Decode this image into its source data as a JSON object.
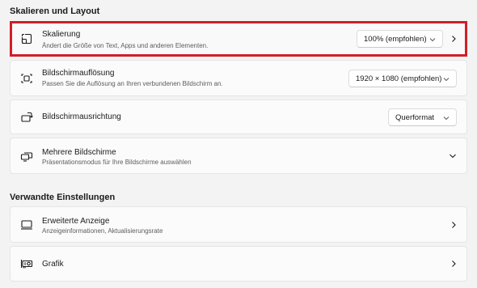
{
  "sections": {
    "layout_title": "Skalieren und Layout",
    "related_title": "Verwandte Einstellungen"
  },
  "scaling": {
    "title": "Skalierung",
    "subtitle": "Ändert die Größe von Text, Apps und anderen Elementen.",
    "value": "100% (empfohlen)",
    "icon": "scale-icon"
  },
  "resolution": {
    "title": "Bildschirmauflösung",
    "subtitle": "Passen Sie die Auflösung an Ihren verbundenen Bildschirm an.",
    "value": "1920 × 1080 (empfohlen)",
    "icon": "resolution-icon"
  },
  "orientation": {
    "title": "Bildschirmausrichtung",
    "value": "Querformat",
    "icon": "orientation-icon"
  },
  "multiple": {
    "title": "Mehrere Bildschirme",
    "subtitle": "Präsentationsmodus für Ihre Bildschirme auswählen",
    "icon": "multiple-displays-icon"
  },
  "advanced": {
    "title": "Erweiterte Anzeige",
    "subtitle": "Anzeigeinformationen, Aktualisierungsrate",
    "icon": "monitor-icon"
  },
  "graphics": {
    "title": "Grafik",
    "icon": "graphics-card-icon"
  },
  "colors": {
    "highlight": "#d01f27",
    "background": "#f3f3f3",
    "card": "#fbfbfb"
  }
}
